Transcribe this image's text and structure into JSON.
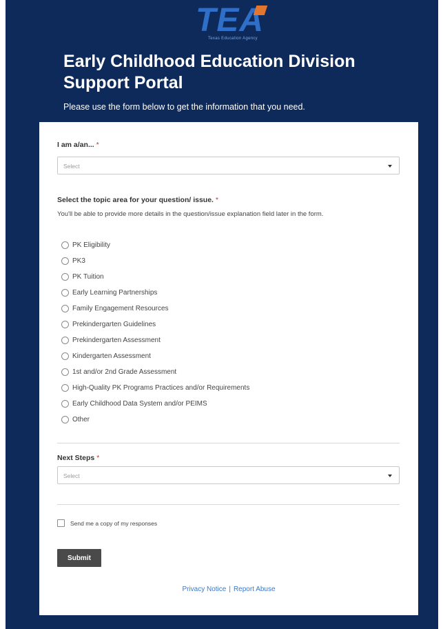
{
  "brand": {
    "logo_text": "TEA",
    "logo_subtitle": "Texas Education Agency",
    "colors": {
      "page_background": "#0e2a5a",
      "logo_blue": "#2f6fc8",
      "logo_orange": "#e2762e",
      "link": "#3a78c9",
      "required": "#c0392b",
      "submit_bg": "#4a4a4a"
    }
  },
  "header": {
    "title": "Early Childhood Education Division Support Portal",
    "subtitle": "Please use the form below to get the information that you need."
  },
  "form": {
    "role": {
      "label": "I am a/an...",
      "required_mark": "*",
      "placeholder": "Select"
    },
    "topic": {
      "label": "Select the topic area for your question/ issue.",
      "required_mark": "*",
      "helper": "You'll be able to provide more details in the question/issue explanation field later in the form.",
      "options": [
        "PK Eligibility",
        "PK3",
        "PK Tuition",
        "Early Learning Partnerships",
        "Family Engagement Resources",
        "Prekindergarten Guidelines",
        "Prekindergarten Assessment",
        "Kindergarten Assessment",
        "1st and/or 2nd Grade Assessment",
        "High-Quality PK Programs Practices and/or Requirements",
        "Early Childhood Data System and/or PEIMS",
        "Other"
      ]
    },
    "next_steps": {
      "label": "Next Steps",
      "required_mark": "*",
      "placeholder": "Select"
    },
    "copy_checkbox_label": "Send me a copy of my responses",
    "submit_label": "Submit"
  },
  "footer": {
    "privacy_label": "Privacy Notice",
    "separator": "|",
    "report_label": "Report Abuse"
  }
}
